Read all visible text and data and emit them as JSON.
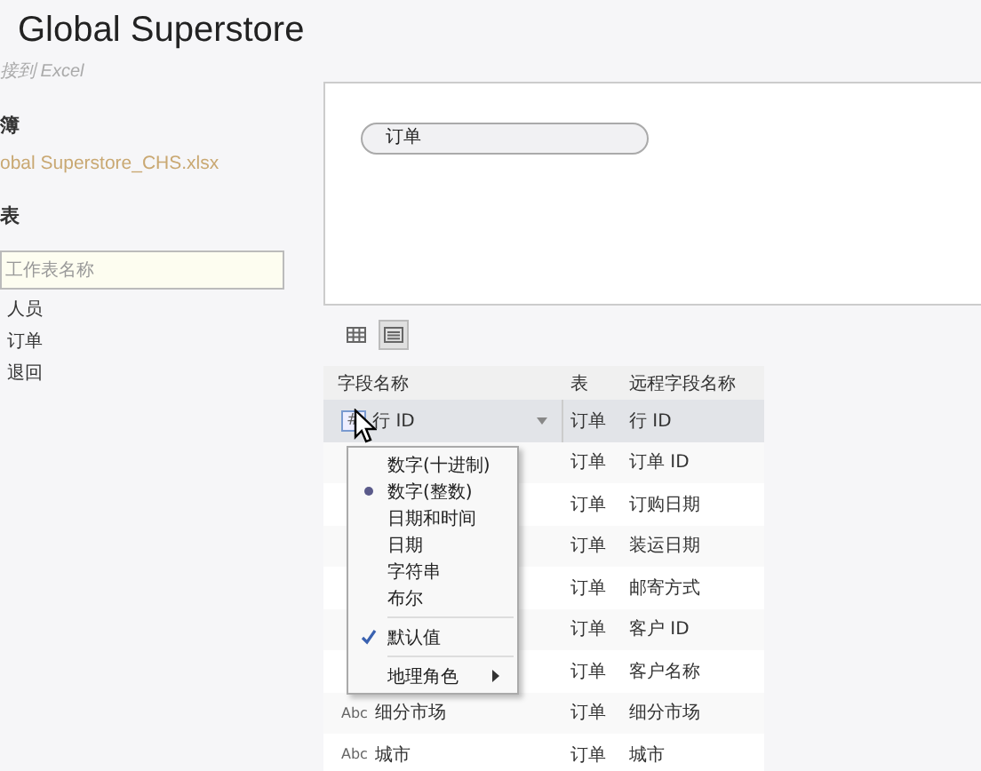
{
  "window": {
    "title": "Global Superstore",
    "subtitle": "接到 Excel"
  },
  "sidebar": {
    "workbook_heading": "簿",
    "file": "obal Superstore_CHS.xlsx",
    "sheets_heading": "表",
    "search": {
      "placeholder": "工作表名称"
    },
    "sheets": [
      {
        "label": "人员"
      },
      {
        "label": "订单"
      },
      {
        "label": "退回"
      }
    ]
  },
  "canvas": {
    "tables": [
      {
        "label": "订单"
      }
    ]
  },
  "view_toggle": [
    {
      "kind": "grid",
      "selected": false
    },
    {
      "kind": "list",
      "selected": true
    }
  ],
  "table": {
    "columns": [
      "字段名称",
      "表",
      "远程字段名称"
    ],
    "rows": [
      {
        "type_label": "#",
        "field": "行 ID",
        "table": "订单",
        "remote": "行 ID",
        "selected": true
      },
      {
        "table": "订单",
        "remote": "订单 ID",
        "selected": false
      },
      {
        "table": "订单",
        "remote": "订购日期",
        "selected": false
      },
      {
        "table": "订单",
        "remote": "装运日期",
        "selected": false
      },
      {
        "table": "订单",
        "remote": "邮寄方式",
        "selected": false
      },
      {
        "table": "订单",
        "remote": "客户 ID",
        "selected": false
      },
      {
        "table": "订单",
        "remote": "客户名称",
        "selected": false
      },
      {
        "type_label": "Abc",
        "field": "细分市场",
        "table": "订单",
        "remote": "细分市场",
        "selected": false
      },
      {
        "type_label": "Abc",
        "field": "城市",
        "table": "订单",
        "remote": "城市",
        "selected": false
      }
    ]
  },
  "type_menu": {
    "items": [
      {
        "kind": "option",
        "label": "数字(十进制)",
        "selected": false
      },
      {
        "kind": "option",
        "label": "数字(整数)",
        "selected": true
      },
      {
        "kind": "option",
        "label": "日期和时间",
        "selected": false
      },
      {
        "kind": "option",
        "label": "日期",
        "selected": false
      },
      {
        "kind": "option",
        "label": "字符串",
        "selected": false
      },
      {
        "kind": "option",
        "label": "布尔",
        "selected": false
      },
      {
        "kind": "check",
        "label": "默认值",
        "checked": true
      },
      {
        "kind": "submenu",
        "label": "地理角色"
      }
    ]
  }
}
